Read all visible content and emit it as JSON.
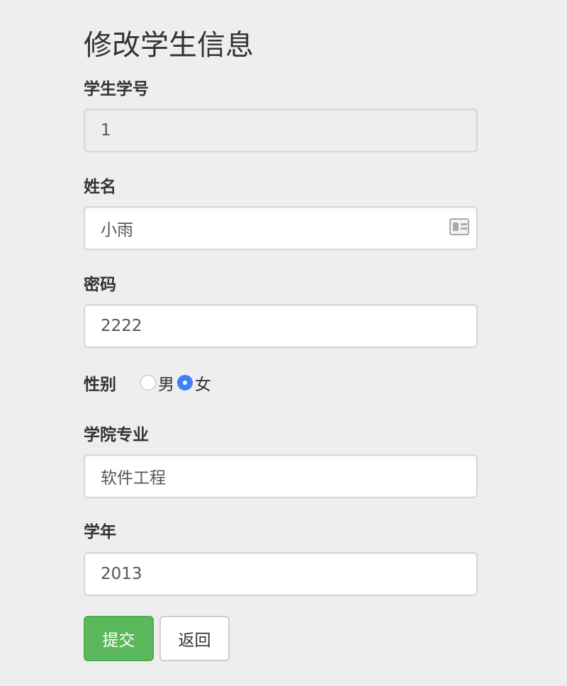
{
  "form": {
    "title": "修改学生信息",
    "student_id": {
      "label": "学生学号",
      "value": "1"
    },
    "name": {
      "label": "姓名",
      "value": "小雨",
      "icon": "contact-card-icon"
    },
    "password": {
      "label": "密码",
      "value": "2222"
    },
    "gender": {
      "label": "性别",
      "options": [
        {
          "label": "男",
          "checked": false
        },
        {
          "label": "女",
          "checked": true
        }
      ]
    },
    "major": {
      "label": "学院专业",
      "value": "软件工程"
    },
    "year": {
      "label": "学年",
      "value": "2013"
    },
    "submit_label": "提交",
    "back_label": "返回"
  },
  "colors": {
    "background": "#eeeeee",
    "submit_button": "#5cb85c",
    "radio_checked": "#3b82f6"
  }
}
